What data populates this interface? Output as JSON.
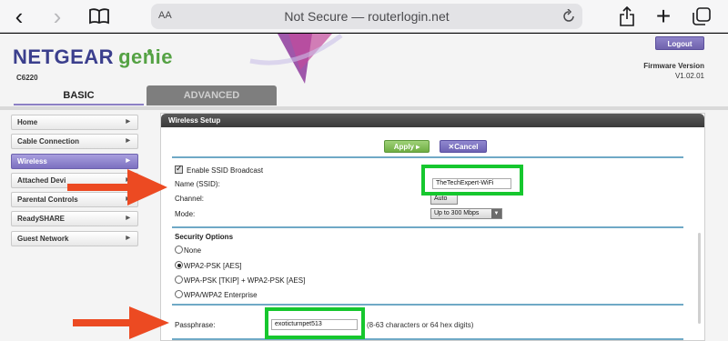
{
  "browser": {
    "text_size_label": "AA",
    "address": "Not Secure — routerlogin.net"
  },
  "header": {
    "brand": "NETGEAR",
    "product": "genie",
    "model": "C6220",
    "logout_label": "Logout",
    "firmware_label": "Firmware Version",
    "firmware_value": "V1.02.01"
  },
  "tabs": [
    {
      "label": "BASIC",
      "active": true
    },
    {
      "label": "ADVANCED",
      "active": false
    }
  ],
  "sidebar": {
    "items": [
      {
        "label": "Home"
      },
      {
        "label": "Cable Connection"
      },
      {
        "label": "Wireless",
        "active": true
      },
      {
        "label": "Attached Devi"
      },
      {
        "label": "Parental Controls"
      },
      {
        "label": "ReadySHARE"
      },
      {
        "label": "Guest Network"
      }
    ]
  },
  "panel": {
    "title": "Wireless Setup",
    "apply_label": "Apply ▸",
    "cancel_label": "✕Cancel",
    "enable_ssid_label": "Enable SSID Broadcast",
    "ssid_label": "Name (SSID):",
    "ssid_value": "TheTechExpert-WiFi",
    "channel_label": "Channel:",
    "channel_value": "Auto",
    "mode_label": "Mode:",
    "mode_value": "Up to 300 Mbps",
    "security_heading": "Security Options",
    "security_options": [
      {
        "label": "None",
        "selected": false
      },
      {
        "label": "WPA2-PSK [AES]",
        "selected": true
      },
      {
        "label": "WPA-PSK [TKIP] + WPA2-PSK [AES]",
        "selected": false
      },
      {
        "label": "WPA/WPA2 Enterprise",
        "selected": false
      }
    ],
    "passphrase_label": "Passphrase:",
    "passphrase_value": "exoticturnpet513",
    "passphrase_hint": "(8-63 characters or 64 hex digits)"
  },
  "colors": {
    "annotation_green": "#16c72e",
    "annotation_arrow": "#ec4a22",
    "accent_purple": "#7c70c0",
    "apply_green": "#6fae43"
  }
}
